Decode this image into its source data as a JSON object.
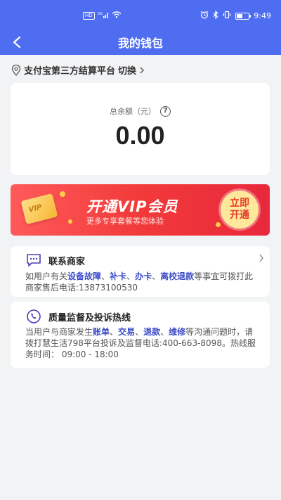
{
  "status_bar": {
    "hd_badge": "HD",
    "network": "5G",
    "time": "9:49"
  },
  "header": {
    "title": "我的钱包",
    "back_icon": "back-arrow-icon",
    "background": "#4f6df0"
  },
  "platform": {
    "name": "支付宝第三方结算平台",
    "switch_label": "切换"
  },
  "balance": {
    "label": "总余额（元）",
    "value": "0.00",
    "help": "?"
  },
  "vip_banner": {
    "card_text": "VIP",
    "title": "开通VIP会员",
    "subtitle": "更多专享套餐等您体验",
    "button_line1": "立即",
    "button_line2": "开通",
    "color": "#f23a3a"
  },
  "contact_card": {
    "title": "联系商家",
    "text_1": "如用户有关",
    "hl_1": "设备故障",
    "sep_1": "、",
    "hl_2": "补卡",
    "sep_2": "、",
    "hl_3": "办卡",
    "sep_3": "、",
    "hl_4": "离校退款",
    "text_2": "等事宜可拨打此商家售后电话:13873100530"
  },
  "hotline_card": {
    "title": "质量监督及投诉热线",
    "text_1": "当用户与商家发生",
    "hl_1": "账单",
    "sep_1": "、",
    "hl_2": "交易",
    "sep_2": "、",
    "hl_3": "退款",
    "sep_3": "、",
    "hl_4": "维修",
    "text_2": "等沟通问题时，请拨打慧生活798平台投诉及监督电话:400-663-8098。热线服务时间： 09:00 - 18:00"
  }
}
